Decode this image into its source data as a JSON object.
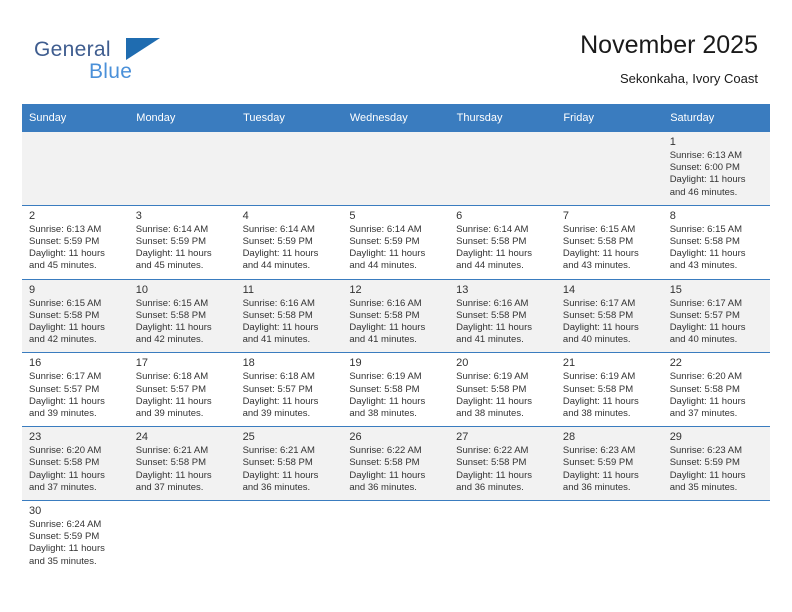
{
  "logo": {
    "line1": "General",
    "line2": "Blue",
    "flag_icon": "flag-icon"
  },
  "header": {
    "title": "November 2025",
    "location": "Sekonkaha, Ivory Coast"
  },
  "weekdays": [
    "Sunday",
    "Monday",
    "Tuesday",
    "Wednesday",
    "Thursday",
    "Friday",
    "Saturday"
  ],
  "weeks": [
    [
      {
        "day": "",
        "lines": []
      },
      {
        "day": "",
        "lines": []
      },
      {
        "day": "",
        "lines": []
      },
      {
        "day": "",
        "lines": []
      },
      {
        "day": "",
        "lines": []
      },
      {
        "day": "",
        "lines": []
      },
      {
        "day": "1",
        "lines": [
          "Sunrise: 6:13 AM",
          "Sunset: 6:00 PM",
          "Daylight: 11 hours",
          "and 46 minutes."
        ]
      }
    ],
    [
      {
        "day": "2",
        "lines": [
          "Sunrise: 6:13 AM",
          "Sunset: 5:59 PM",
          "Daylight: 11 hours",
          "and 45 minutes."
        ]
      },
      {
        "day": "3",
        "lines": [
          "Sunrise: 6:14 AM",
          "Sunset: 5:59 PM",
          "Daylight: 11 hours",
          "and 45 minutes."
        ]
      },
      {
        "day": "4",
        "lines": [
          "Sunrise: 6:14 AM",
          "Sunset: 5:59 PM",
          "Daylight: 11 hours",
          "and 44 minutes."
        ]
      },
      {
        "day": "5",
        "lines": [
          "Sunrise: 6:14 AM",
          "Sunset: 5:59 PM",
          "Daylight: 11 hours",
          "and 44 minutes."
        ]
      },
      {
        "day": "6",
        "lines": [
          "Sunrise: 6:14 AM",
          "Sunset: 5:58 PM",
          "Daylight: 11 hours",
          "and 44 minutes."
        ]
      },
      {
        "day": "7",
        "lines": [
          "Sunrise: 6:15 AM",
          "Sunset: 5:58 PM",
          "Daylight: 11 hours",
          "and 43 minutes."
        ]
      },
      {
        "day": "8",
        "lines": [
          "Sunrise: 6:15 AM",
          "Sunset: 5:58 PM",
          "Daylight: 11 hours",
          "and 43 minutes."
        ]
      }
    ],
    [
      {
        "day": "9",
        "lines": [
          "Sunrise: 6:15 AM",
          "Sunset: 5:58 PM",
          "Daylight: 11 hours",
          "and 42 minutes."
        ]
      },
      {
        "day": "10",
        "lines": [
          "Sunrise: 6:15 AM",
          "Sunset: 5:58 PM",
          "Daylight: 11 hours",
          "and 42 minutes."
        ]
      },
      {
        "day": "11",
        "lines": [
          "Sunrise: 6:16 AM",
          "Sunset: 5:58 PM",
          "Daylight: 11 hours",
          "and 41 minutes."
        ]
      },
      {
        "day": "12",
        "lines": [
          "Sunrise: 6:16 AM",
          "Sunset: 5:58 PM",
          "Daylight: 11 hours",
          "and 41 minutes."
        ]
      },
      {
        "day": "13",
        "lines": [
          "Sunrise: 6:16 AM",
          "Sunset: 5:58 PM",
          "Daylight: 11 hours",
          "and 41 minutes."
        ]
      },
      {
        "day": "14",
        "lines": [
          "Sunrise: 6:17 AM",
          "Sunset: 5:58 PM",
          "Daylight: 11 hours",
          "and 40 minutes."
        ]
      },
      {
        "day": "15",
        "lines": [
          "Sunrise: 6:17 AM",
          "Sunset: 5:57 PM",
          "Daylight: 11 hours",
          "and 40 minutes."
        ]
      }
    ],
    [
      {
        "day": "16",
        "lines": [
          "Sunrise: 6:17 AM",
          "Sunset: 5:57 PM",
          "Daylight: 11 hours",
          "and 39 minutes."
        ]
      },
      {
        "day": "17",
        "lines": [
          "Sunrise: 6:18 AM",
          "Sunset: 5:57 PM",
          "Daylight: 11 hours",
          "and 39 minutes."
        ]
      },
      {
        "day": "18",
        "lines": [
          "Sunrise: 6:18 AM",
          "Sunset: 5:57 PM",
          "Daylight: 11 hours",
          "and 39 minutes."
        ]
      },
      {
        "day": "19",
        "lines": [
          "Sunrise: 6:19 AM",
          "Sunset: 5:58 PM",
          "Daylight: 11 hours",
          "and 38 minutes."
        ]
      },
      {
        "day": "20",
        "lines": [
          "Sunrise: 6:19 AM",
          "Sunset: 5:58 PM",
          "Daylight: 11 hours",
          "and 38 minutes."
        ]
      },
      {
        "day": "21",
        "lines": [
          "Sunrise: 6:19 AM",
          "Sunset: 5:58 PM",
          "Daylight: 11 hours",
          "and 38 minutes."
        ]
      },
      {
        "day": "22",
        "lines": [
          "Sunrise: 6:20 AM",
          "Sunset: 5:58 PM",
          "Daylight: 11 hours",
          "and 37 minutes."
        ]
      }
    ],
    [
      {
        "day": "23",
        "lines": [
          "Sunrise: 6:20 AM",
          "Sunset: 5:58 PM",
          "Daylight: 11 hours",
          "and 37 minutes."
        ]
      },
      {
        "day": "24",
        "lines": [
          "Sunrise: 6:21 AM",
          "Sunset: 5:58 PM",
          "Daylight: 11 hours",
          "and 37 minutes."
        ]
      },
      {
        "day": "25",
        "lines": [
          "Sunrise: 6:21 AM",
          "Sunset: 5:58 PM",
          "Daylight: 11 hours",
          "and 36 minutes."
        ]
      },
      {
        "day": "26",
        "lines": [
          "Sunrise: 6:22 AM",
          "Sunset: 5:58 PM",
          "Daylight: 11 hours",
          "and 36 minutes."
        ]
      },
      {
        "day": "27",
        "lines": [
          "Sunrise: 6:22 AM",
          "Sunset: 5:58 PM",
          "Daylight: 11 hours",
          "and 36 minutes."
        ]
      },
      {
        "day": "28",
        "lines": [
          "Sunrise: 6:23 AM",
          "Sunset: 5:59 PM",
          "Daylight: 11 hours",
          "and 36 minutes."
        ]
      },
      {
        "day": "29",
        "lines": [
          "Sunrise: 6:23 AM",
          "Sunset: 5:59 PM",
          "Daylight: 11 hours",
          "and 35 minutes."
        ]
      }
    ],
    [
      {
        "day": "30",
        "lines": [
          "Sunrise: 6:24 AM",
          "Sunset: 5:59 PM",
          "Daylight: 11 hours",
          "and 35 minutes."
        ]
      },
      {
        "day": "",
        "lines": []
      },
      {
        "day": "",
        "lines": []
      },
      {
        "day": "",
        "lines": []
      },
      {
        "day": "",
        "lines": []
      },
      {
        "day": "",
        "lines": []
      },
      {
        "day": "",
        "lines": []
      }
    ]
  ],
  "colors": {
    "header_blue": "#3a7cbf",
    "logo_dark": "#3f5d8f",
    "logo_light": "#4a90d9",
    "shade_row": "#f2f2f2"
  }
}
